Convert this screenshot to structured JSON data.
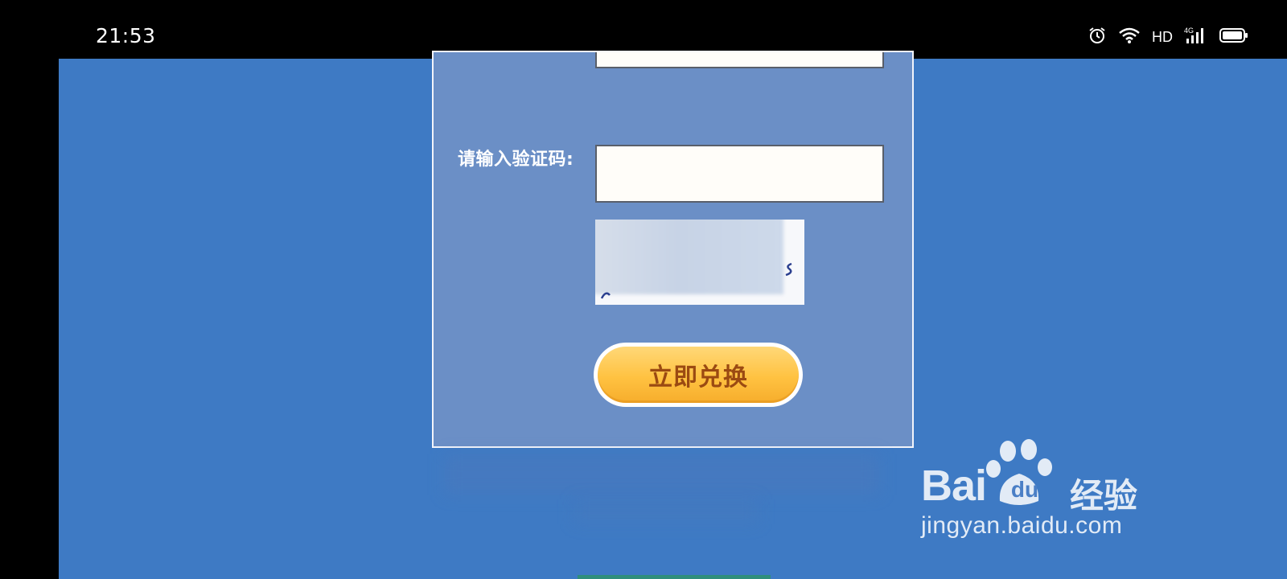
{
  "status_bar": {
    "time": "21:53",
    "icons": [
      "alarm-icon",
      "wifi-icon",
      "hd-indicator",
      "signal-4g-icon",
      "battery-icon"
    ],
    "hd_label": "HD",
    "network_label": "4G"
  },
  "form": {
    "captcha_label": "请输入验证码:",
    "captcha_input_value": "",
    "redeem_button_label": "立即兑换"
  },
  "watermark": {
    "brand_bai": "Bai",
    "brand_du": "du",
    "brand_jingyan": "经验",
    "url": "jingyan.baidu.com"
  },
  "colors": {
    "page_background": "#3e7ac4",
    "panel_background": "#6b8fc6",
    "button_fill": "#ffc241",
    "button_text": "#9b4a12"
  }
}
